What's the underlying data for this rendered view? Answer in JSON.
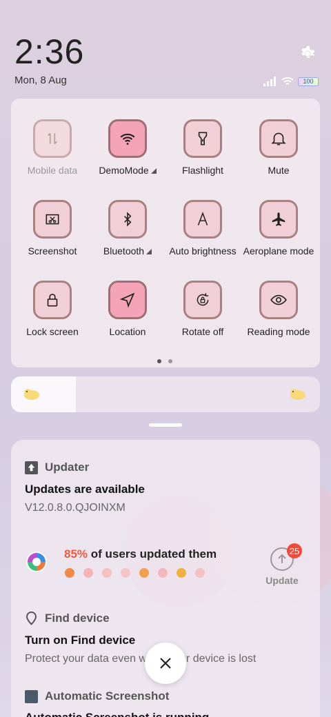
{
  "status": {
    "time": "2:36",
    "date": "Mon, 8 Aug",
    "battery": "100"
  },
  "quick_settings": {
    "tiles": [
      {
        "label": "Mobile data",
        "icon": "mobile-data-icon",
        "active": false,
        "disabled": true
      },
      {
        "label": "DemoMode",
        "icon": "wifi-icon",
        "active": true,
        "expandable": true
      },
      {
        "label": "Flashlight",
        "icon": "flashlight-icon",
        "active": false
      },
      {
        "label": "Mute",
        "icon": "bell-icon",
        "active": false
      },
      {
        "label": "Screenshot",
        "icon": "screenshot-icon",
        "active": false
      },
      {
        "label": "Bluetooth",
        "icon": "bluetooth-icon",
        "active": false,
        "expandable": true
      },
      {
        "label": "Auto brightness",
        "icon": "auto-brightness-icon",
        "active": false
      },
      {
        "label": "Aeroplane mode",
        "icon": "aeroplane-icon",
        "active": false
      },
      {
        "label": "Lock screen",
        "icon": "lock-icon",
        "active": false
      },
      {
        "label": "Location",
        "icon": "location-icon",
        "active": true
      },
      {
        "label": "Rotate off",
        "icon": "rotate-lock-icon",
        "active": false
      },
      {
        "label": "Reading mode",
        "icon": "eye-icon",
        "active": false
      }
    ],
    "page": 1,
    "page_count": 2
  },
  "brightness": {
    "level": 0.21
  },
  "notifications": {
    "updater": {
      "app": "Updater",
      "title": "Updates are available",
      "version": "V12.0.8.0.QJOINXM",
      "percent": "85%",
      "percent_suffix": " of users updated them",
      "button": "Update",
      "badge": "25"
    },
    "find_device": {
      "app": "Find device",
      "title": "Turn on Find device",
      "body": "Protect your data even when your device is lost"
    },
    "screenshot": {
      "app": "Automatic Screenshot",
      "title": "Automatic Screenshot is running"
    }
  },
  "colors": {
    "accent": "#f5a3b8",
    "tile_border": "#a88080",
    "percent": "#ef5a3a",
    "badge": "#f04a3a"
  }
}
